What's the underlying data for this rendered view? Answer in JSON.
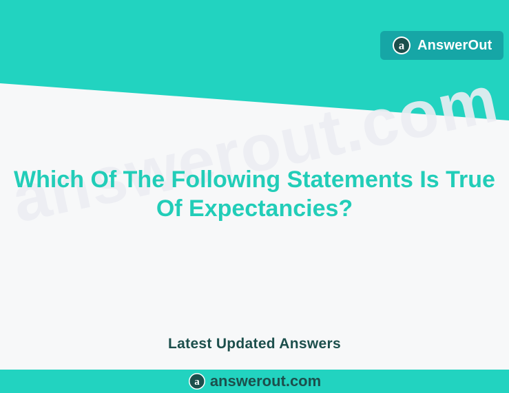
{
  "brand": {
    "name": "AnswerOut",
    "logo_icon": "answerout-a-logo-icon",
    "badge_color": "#16a6a6"
  },
  "header": {
    "band_color": "#22d3c0"
  },
  "watermark": {
    "text": "answerout.com"
  },
  "content": {
    "headline": "Which Of The Following Statements Is True Of Expectancies?",
    "headline_color": "#22cdb8",
    "subtitle": "Latest Updated Answers"
  },
  "footer": {
    "site": "answerout.com",
    "logo_icon": "answerout-a-logo-icon",
    "band_color": "#22d3c0",
    "text_color": "#1c4f4c"
  }
}
